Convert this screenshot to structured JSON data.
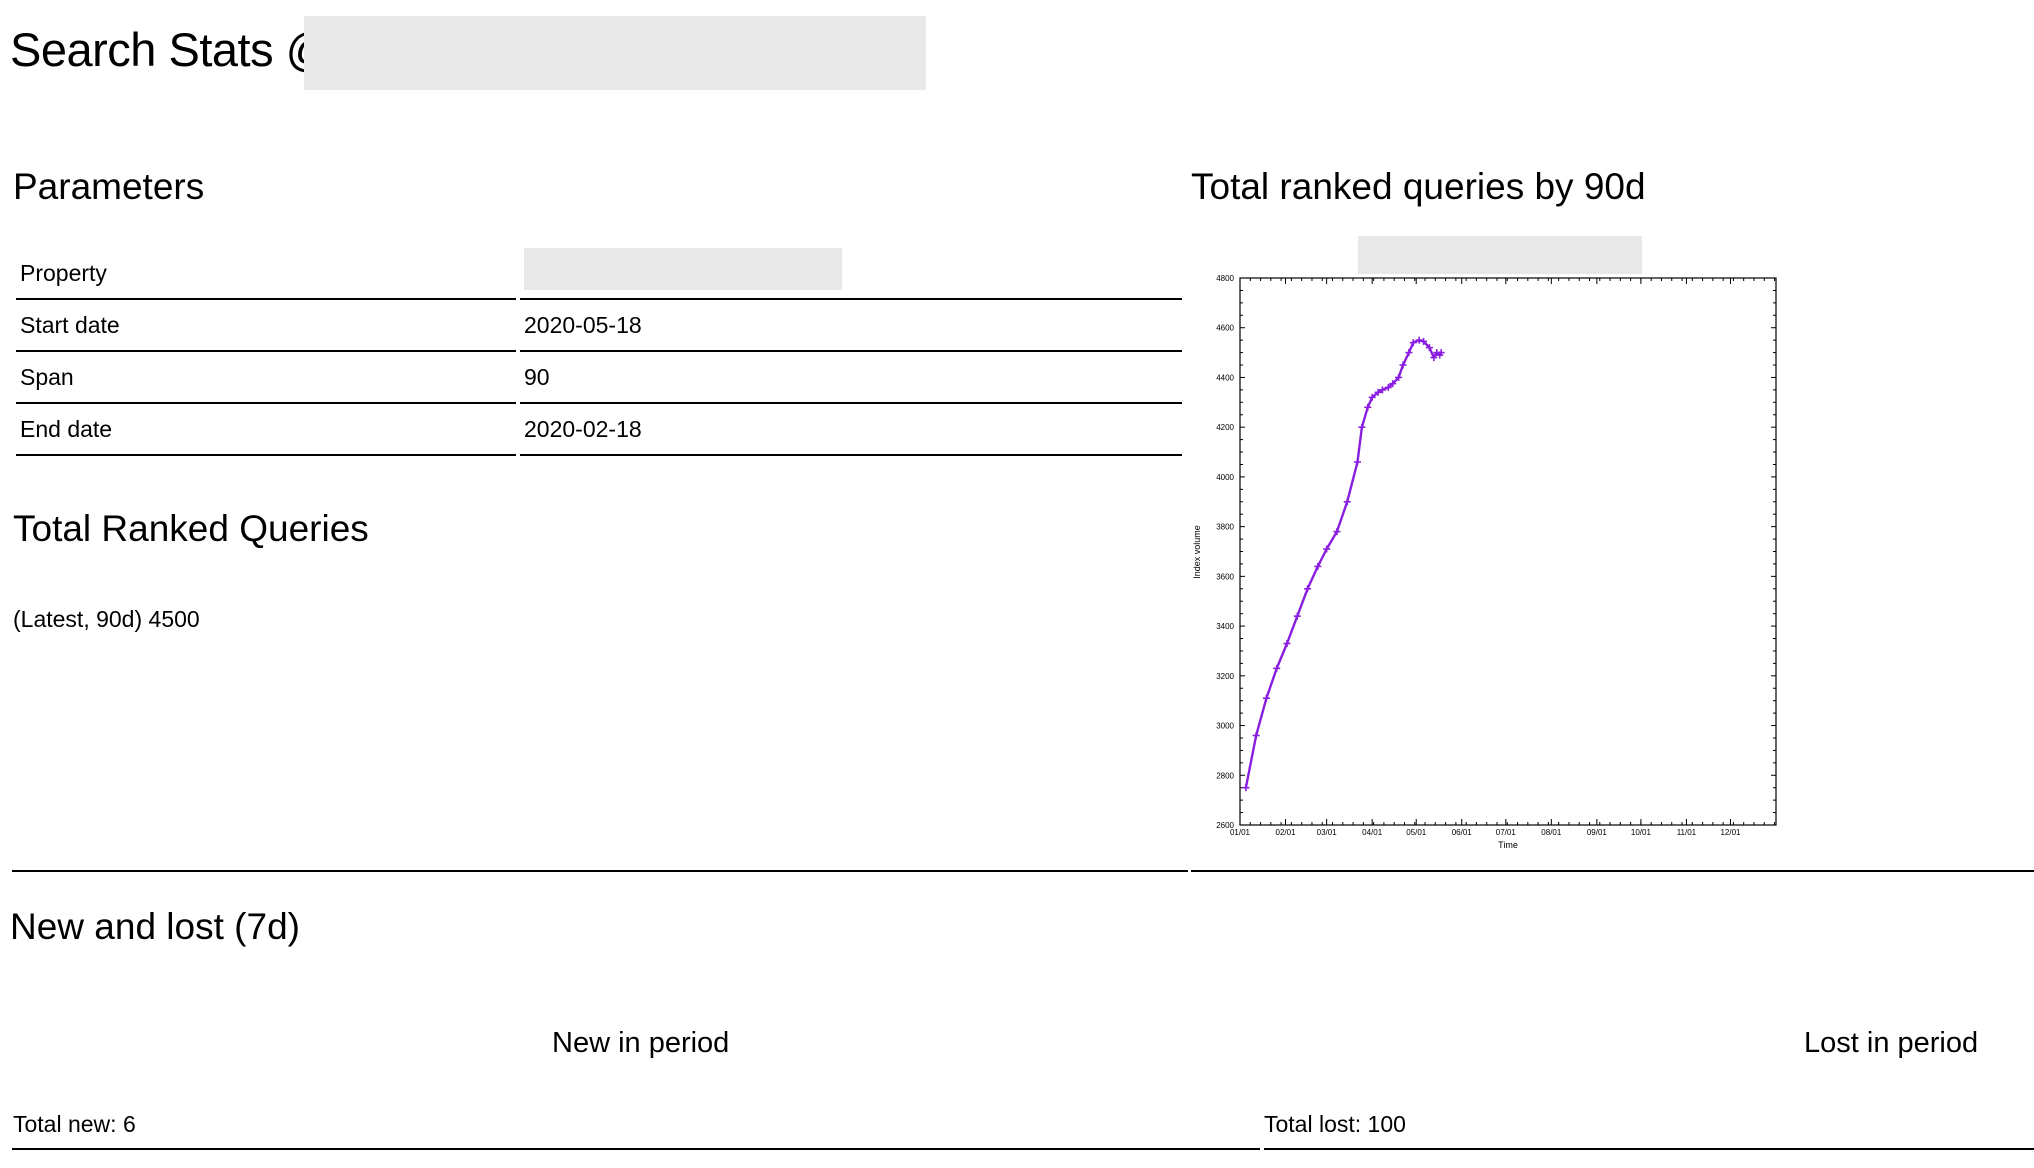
{
  "header": {
    "title": "Search Stats @"
  },
  "parameters": {
    "heading": "Parameters",
    "rows": [
      {
        "label": "Property",
        "value": ""
      },
      {
        "label": "Start date",
        "value": "2020-05-18"
      },
      {
        "label": "Span",
        "value": "90"
      },
      {
        "label": "End date",
        "value": "2020-02-18"
      }
    ]
  },
  "total_ranked": {
    "heading": "Total Ranked Queries",
    "latest_label": "(Latest, 90d)",
    "latest_value": "4500"
  },
  "chart_section": {
    "heading": "Total ranked queries by 90d"
  },
  "new_lost": {
    "heading": "New and lost (7d)",
    "new_heading": "New in period",
    "lost_heading": "Lost in period",
    "total_new": "Total new: 6",
    "total_lost": "Total lost: 100"
  },
  "chart_data": {
    "type": "line",
    "title": "",
    "xlabel": "Time",
    "ylabel": "Index volume",
    "ylim": [
      2600,
      4800
    ],
    "yticks": [
      "2600",
      "2800",
      "3000",
      "3200",
      "3400",
      "3600",
      "3800",
      "4000",
      "4200",
      "4400",
      "4600",
      "4800"
    ],
    "xticks": [
      "01/01",
      "02/01",
      "03/01",
      "04/01",
      "05/01",
      "06/01",
      "07/01",
      "08/01",
      "09/01",
      "10/01",
      "11/01",
      "12/01"
    ],
    "xlim_days": [
      0,
      365
    ],
    "line_color": "#8a1ee0",
    "grid": false,
    "series": [
      {
        "name": "",
        "x": [
          "01/05",
          "01/12",
          "01/19",
          "01/26",
          "02/02",
          "02/09",
          "02/16",
          "02/23",
          "03/01",
          "03/08",
          "03/15",
          "03/22",
          "03/25",
          "03/29",
          "04/01",
          "04/05",
          "04/08",
          "04/12",
          "04/15",
          "04/19",
          "04/22",
          "04/26",
          "04/29",
          "05/03",
          "05/06",
          "05/10",
          "05/13",
          "05/15",
          "05/17",
          "05/18"
        ],
        "y": [
          2750,
          2960,
          3110,
          3230,
          3330,
          3440,
          3550,
          3640,
          3710,
          3780,
          3900,
          4060,
          4200,
          4280,
          4320,
          4340,
          4350,
          4360,
          4375,
          4400,
          4450,
          4500,
          4540,
          4550,
          4545,
          4520,
          4480,
          4500,
          4490,
          4500
        ]
      }
    ]
  }
}
